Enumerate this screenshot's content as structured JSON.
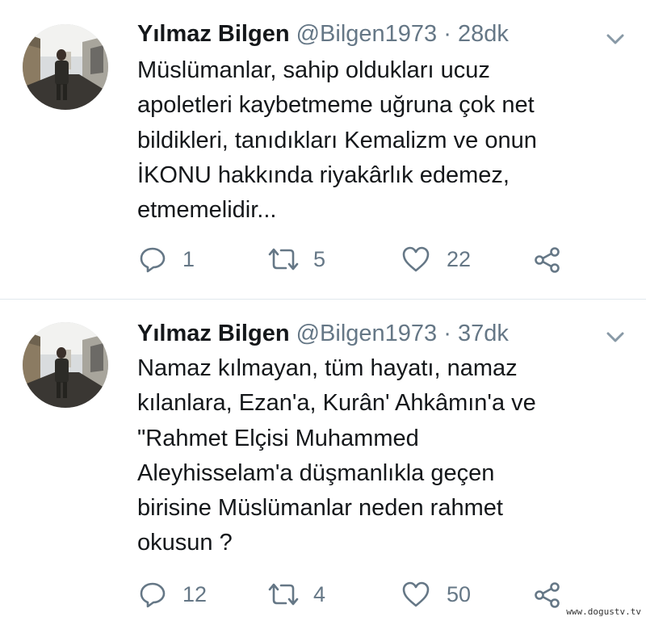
{
  "tweets": [
    {
      "name": "Yılmaz Bilgen",
      "handle": "@Bilgen1973",
      "separator": "·",
      "time": "28dk",
      "lines": [
        "Müslümanlar, sahip oldukları ucuz",
        "apoletleri kaybetmeme uğruna çok net",
        "bildikleri, tanıdıkları Kemalizm ve onun",
        "İKONU hakkında riyakârlık edemez,",
        "etmemelidir..."
      ],
      "replies": "1",
      "retweets": "5",
      "likes": "22"
    },
    {
      "name": "Yılmaz Bilgen",
      "handle": "@Bilgen1973",
      "separator": "·",
      "time": "37dk",
      "lines": [
        "Namaz kılmayan, tüm hayatı, namaz",
        "kılanlara, Ezan'a, Kurân' Ahkâmın'a ve",
        "\"Rahmet  Elçisi Muhammed",
        "Aleyhisselam'a düşmanlıkla geçen",
        "birisine Müslümanlar neden rahmet",
        "okusun ?"
      ],
      "replies": "12",
      "retweets": "4",
      "likes": "50"
    }
  ],
  "icons": [
    "chevron-down-icon",
    "reply-icon",
    "retweet-icon",
    "like-icon",
    "share-icon"
  ],
  "colors": {
    "text": "#14171a",
    "secondary": "#657786",
    "divider": "#e1e8ed"
  },
  "watermark": "www.dogustv.tv"
}
